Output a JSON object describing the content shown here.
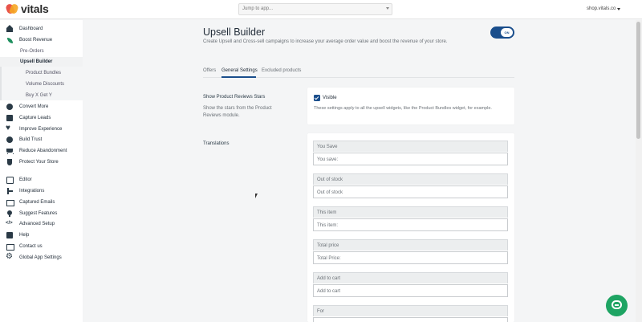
{
  "brand": {
    "name": "vitals"
  },
  "topbar": {
    "jump_placeholder": "Jump to app...",
    "shop": "shop.vitals.co"
  },
  "sidebar": {
    "items": [
      {
        "label": "Dashboard"
      },
      {
        "label": "Boost Revenue"
      },
      {
        "label": "Pre-Orders"
      },
      {
        "label": "Upsell Builder"
      },
      {
        "label": "Product Bundles"
      },
      {
        "label": "Volume Discounts"
      },
      {
        "label": "Buy X Get Y"
      },
      {
        "label": "Convert More"
      },
      {
        "label": "Capture Leads"
      },
      {
        "label": "Improve Experience"
      },
      {
        "label": "Build Trust"
      },
      {
        "label": "Reduce Abandonment"
      },
      {
        "label": "Protect Your Store"
      },
      {
        "label": "Editor"
      },
      {
        "label": "Integrations"
      },
      {
        "label": "Captured Emails"
      },
      {
        "label": "Suggest Features"
      },
      {
        "label": "Advanced Setup"
      },
      {
        "label": "Help"
      },
      {
        "label": "Contact us"
      },
      {
        "label": "Global App Settings"
      }
    ]
  },
  "main": {
    "title": "Upsell Builder",
    "subtitle": "Create Upsell and Cross-sell campaigns to increase your average order value and boost the revenue of your store.",
    "toggle_label": "ON",
    "tabs": [
      {
        "label": "Offers"
      },
      {
        "label": "General Settings"
      },
      {
        "label": "Excluded products"
      }
    ],
    "reviews": {
      "label": "Show Product Reviews Stars",
      "help": "Show the stars from the Product Reviews module.",
      "checkbox_label": "Visible",
      "checkbox_help": "These settings apply to all the upsell widgets, like the Product Bundles widget, for example."
    },
    "translations": {
      "label": "Translations",
      "fields": [
        {
          "label": "You Save",
          "value": "You save:"
        },
        {
          "label": "Out of stock",
          "value": "Out of stock"
        },
        {
          "label": "This item",
          "value": "This item:"
        },
        {
          "label": "Total price",
          "value": "Total Price:"
        },
        {
          "label": "Add to cart",
          "value": "Add to cart"
        },
        {
          "label": "For",
          "value": ""
        }
      ]
    }
  },
  "colors": {
    "accent": "#1a4e8c",
    "brand_green": "#1e8f5e",
    "chat": "#1ea463"
  }
}
